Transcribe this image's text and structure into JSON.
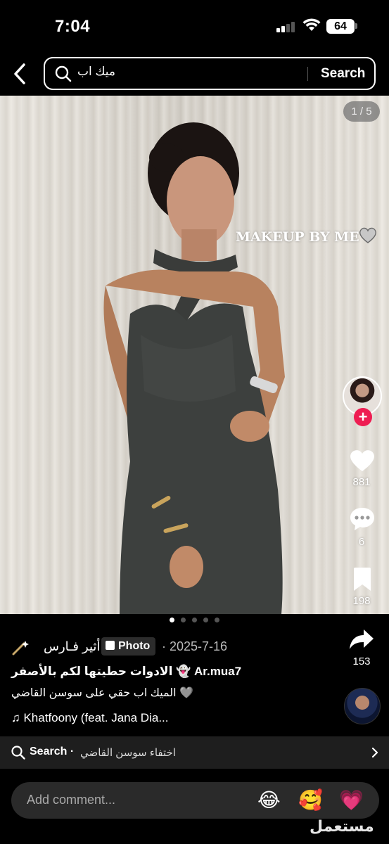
{
  "status_bar": {
    "time": "7:04",
    "battery": "64"
  },
  "search": {
    "query": "ميك اب",
    "button_label": "Search"
  },
  "post": {
    "page_counter": "1 / 5",
    "overlay_caption": "MAKEUP BY ME",
    "likes": "881",
    "comments": "6",
    "saves": "198",
    "shares": "153",
    "author": "أثير فـارس",
    "type_badge": "Photo",
    "date": "· 2025-7-16",
    "title": "الادوات حطيتها لكم بالأصفر 👻 Ar.mua7",
    "description": "الميك اب حقي على سوسن القاضي 🩶",
    "music": "♫ Khatfoony (feat. Jana Dia..."
  },
  "related_search": {
    "label": "Search ·",
    "term": "اختفاء سوسن القاضي"
  },
  "comment_bar": {
    "placeholder": "Add comment...",
    "emojis": [
      "😂",
      "🥰",
      "💗"
    ]
  },
  "watermark": "مستعمل",
  "icons": [
    "back-icon",
    "search-icon",
    "heart-icon",
    "comment-icon",
    "bookmark-icon",
    "share-icon",
    "chevron-right-icon",
    "music-note-icon",
    "wand-icon"
  ]
}
